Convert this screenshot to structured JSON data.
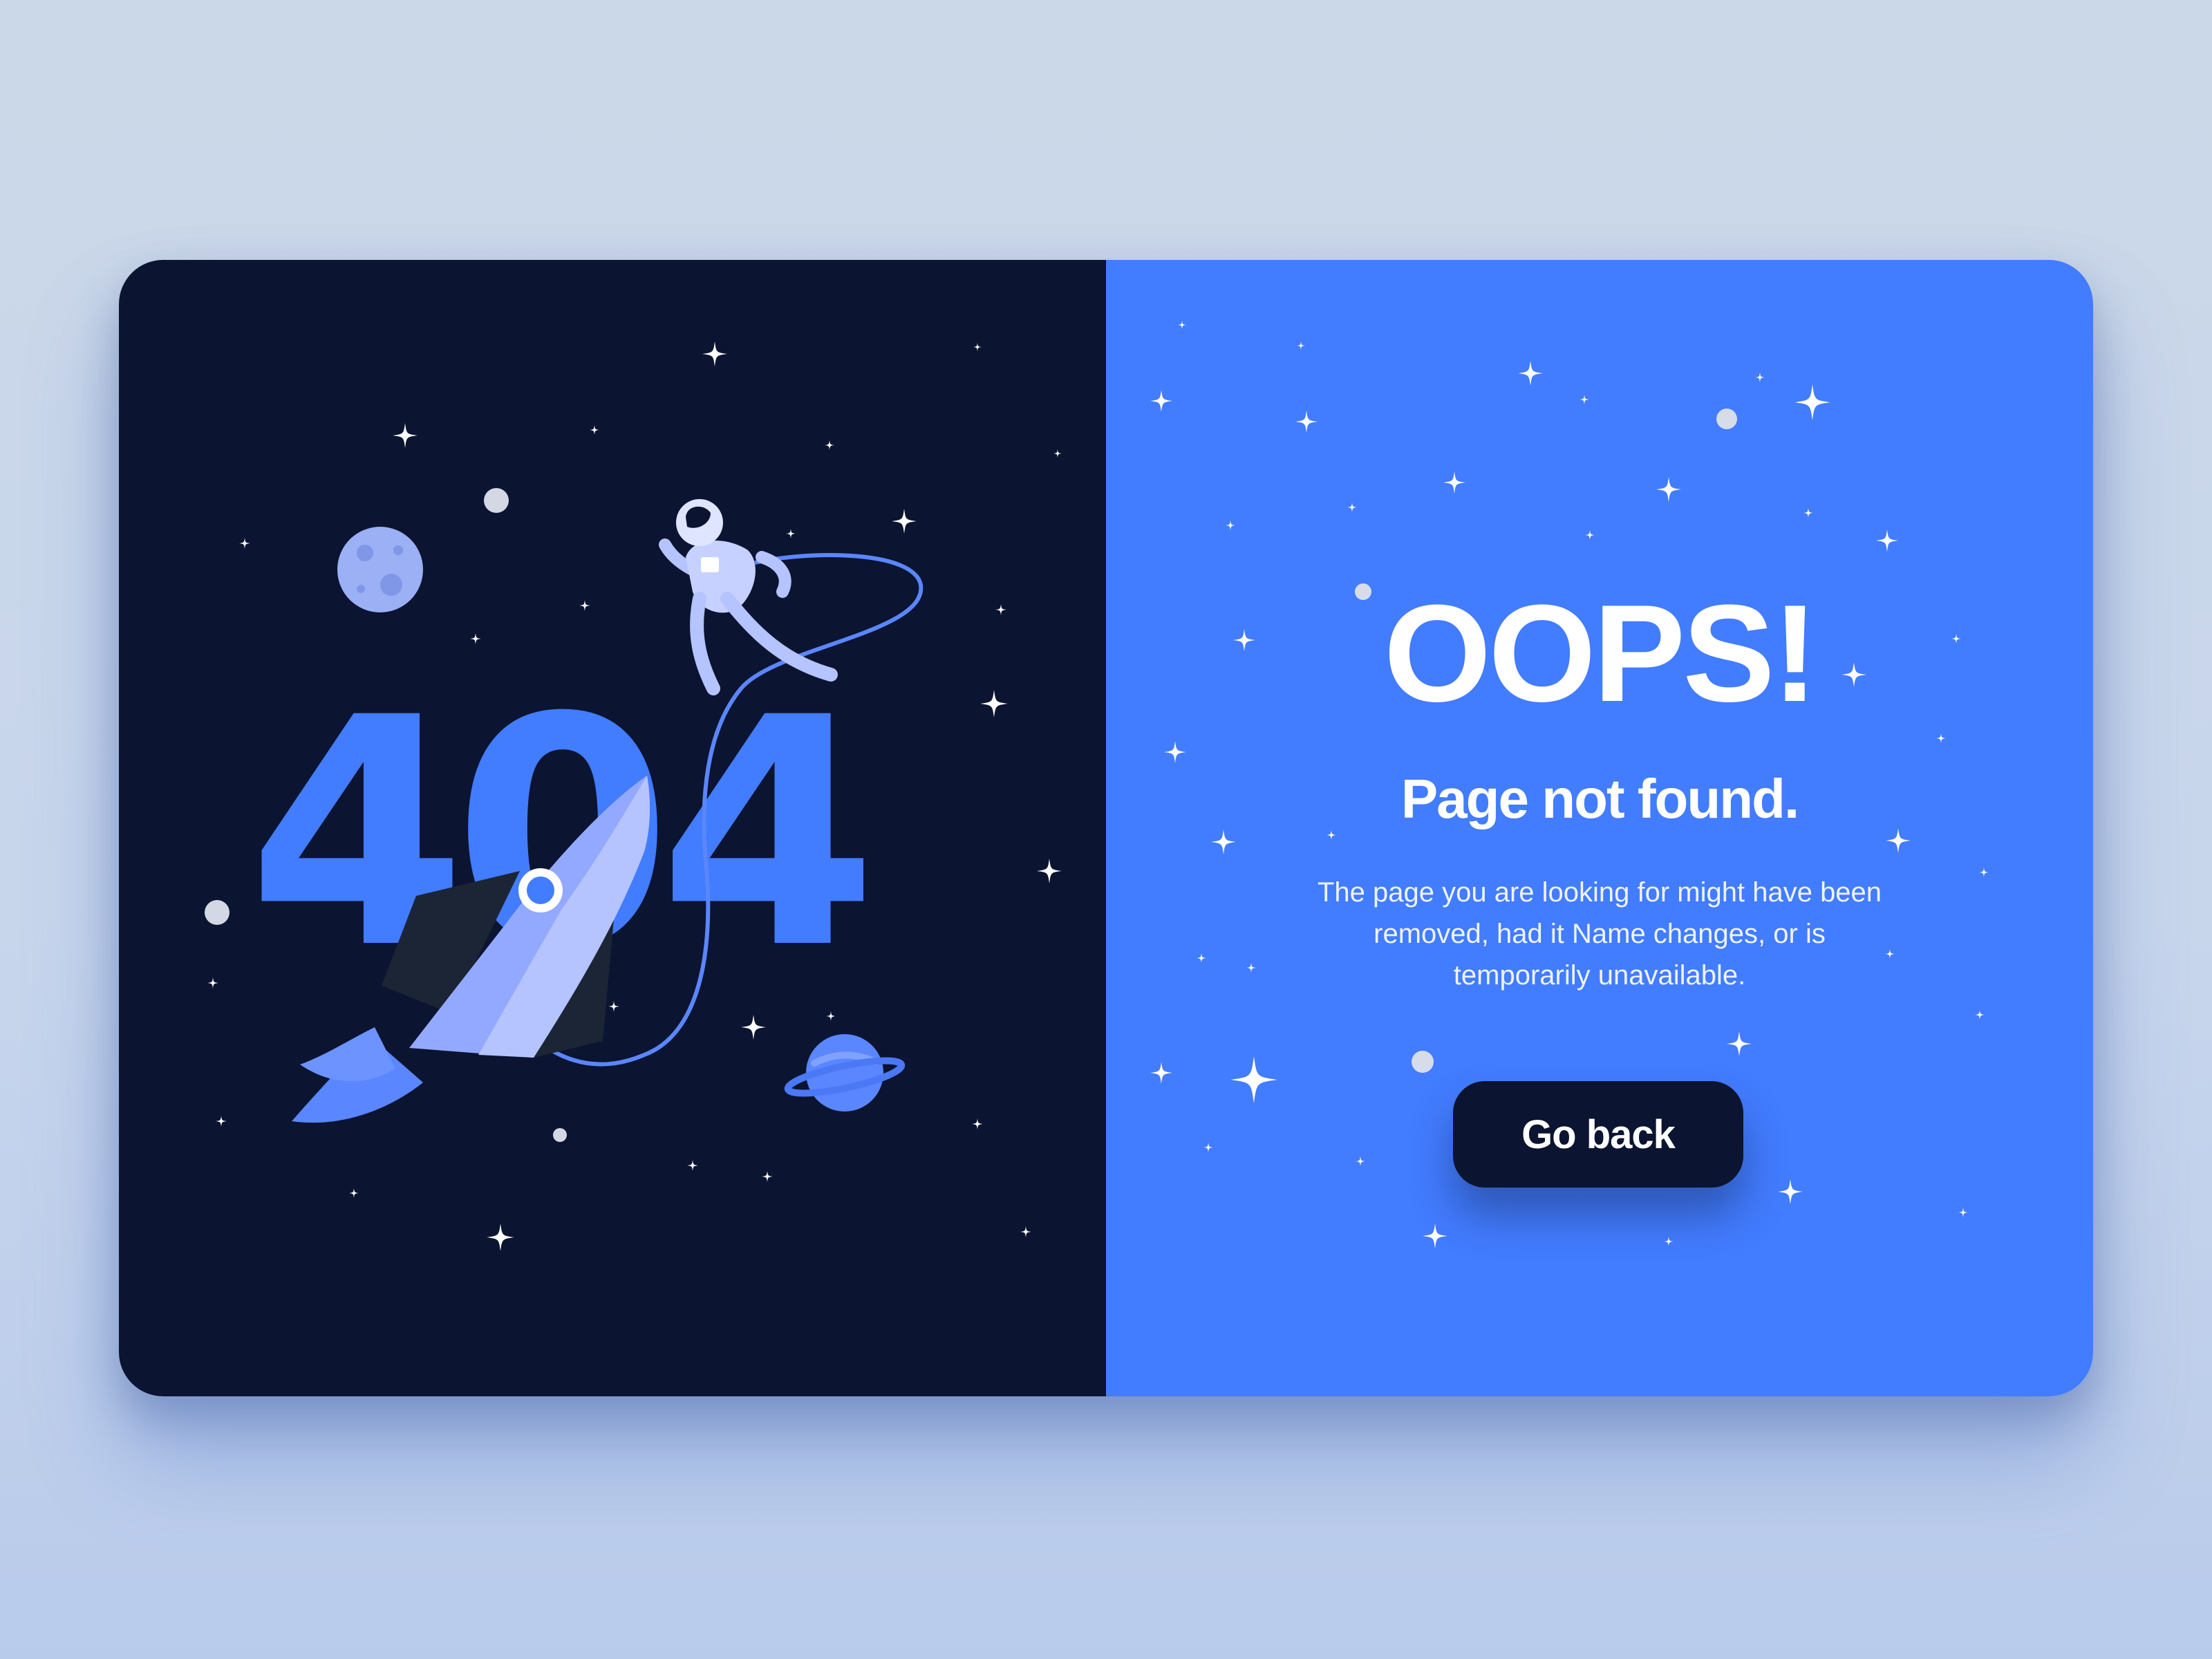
{
  "illustration": {
    "error_code": "404",
    "scene": "astronaut-rocket-space"
  },
  "error_panel": {
    "title": "OOPS!",
    "subtitle": "Page not found.",
    "message_line1": "The page you are looking for might have been",
    "message_line2": "removed, had it Name changes,  or is",
    "message_line3": "temporarily unavailable.",
    "button_label": "Go back"
  },
  "colors": {
    "background": "#cbd8e8",
    "left_panel": "#0b1430",
    "right_panel": "#427cff",
    "accent": "#427cff",
    "light_accent": "#93a9ff",
    "button_bg": "#0b1430",
    "text": "#ffffff"
  }
}
